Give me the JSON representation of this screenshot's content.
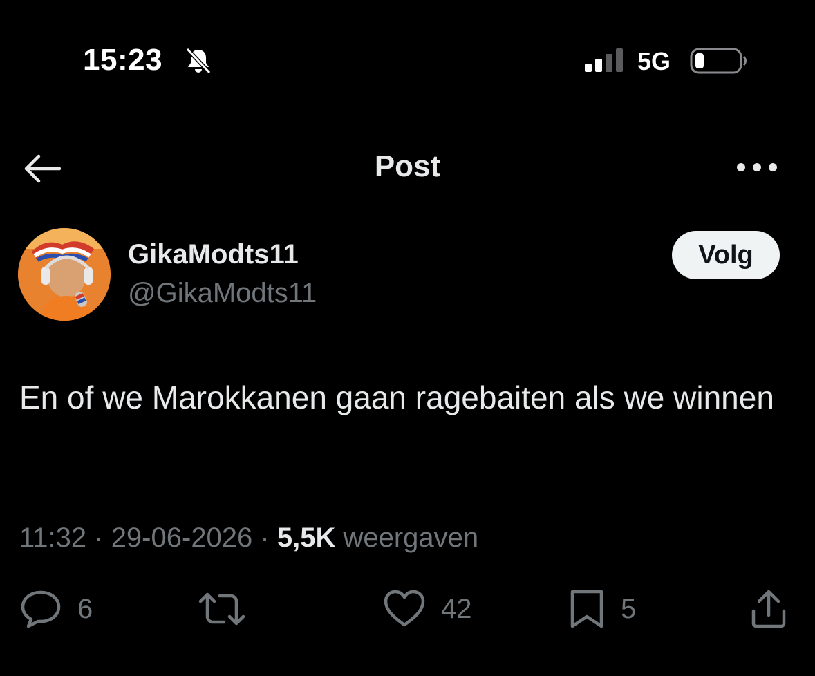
{
  "status_bar": {
    "time": "15:23",
    "network": "5G",
    "icons": [
      "bell-slash-icon",
      "signal-icon",
      "battery-icon"
    ]
  },
  "header": {
    "title": "Post",
    "icons": [
      "arrow-left-icon",
      "more-horizontal-icon"
    ]
  },
  "author": {
    "display_name": "GikaModts11",
    "handle": "@GikaModts11",
    "follow_label": "Volg",
    "avatar_colors": [
      "#f59a3c",
      "#e8762a",
      "#c85b1c"
    ]
  },
  "post": {
    "text": "En of we Marokkanen gaan ragebaiten als we winnen",
    "time": "11:32",
    "date": "29-06-2026",
    "separator": " · ",
    "views_count": "5,5K",
    "views_label": "weergaven"
  },
  "actions": {
    "reply_count": "6",
    "like_count": "42",
    "bookmark_count": "5",
    "icons": [
      "reply-icon",
      "retweet-icon",
      "like-icon",
      "bookmark-icon",
      "share-icon"
    ]
  },
  "colors": {
    "background": "#000000",
    "primary_text": "#e7e9ea",
    "secondary_text": "#71767b",
    "button_bg": "#eff3f4",
    "button_text": "#0f1419"
  }
}
